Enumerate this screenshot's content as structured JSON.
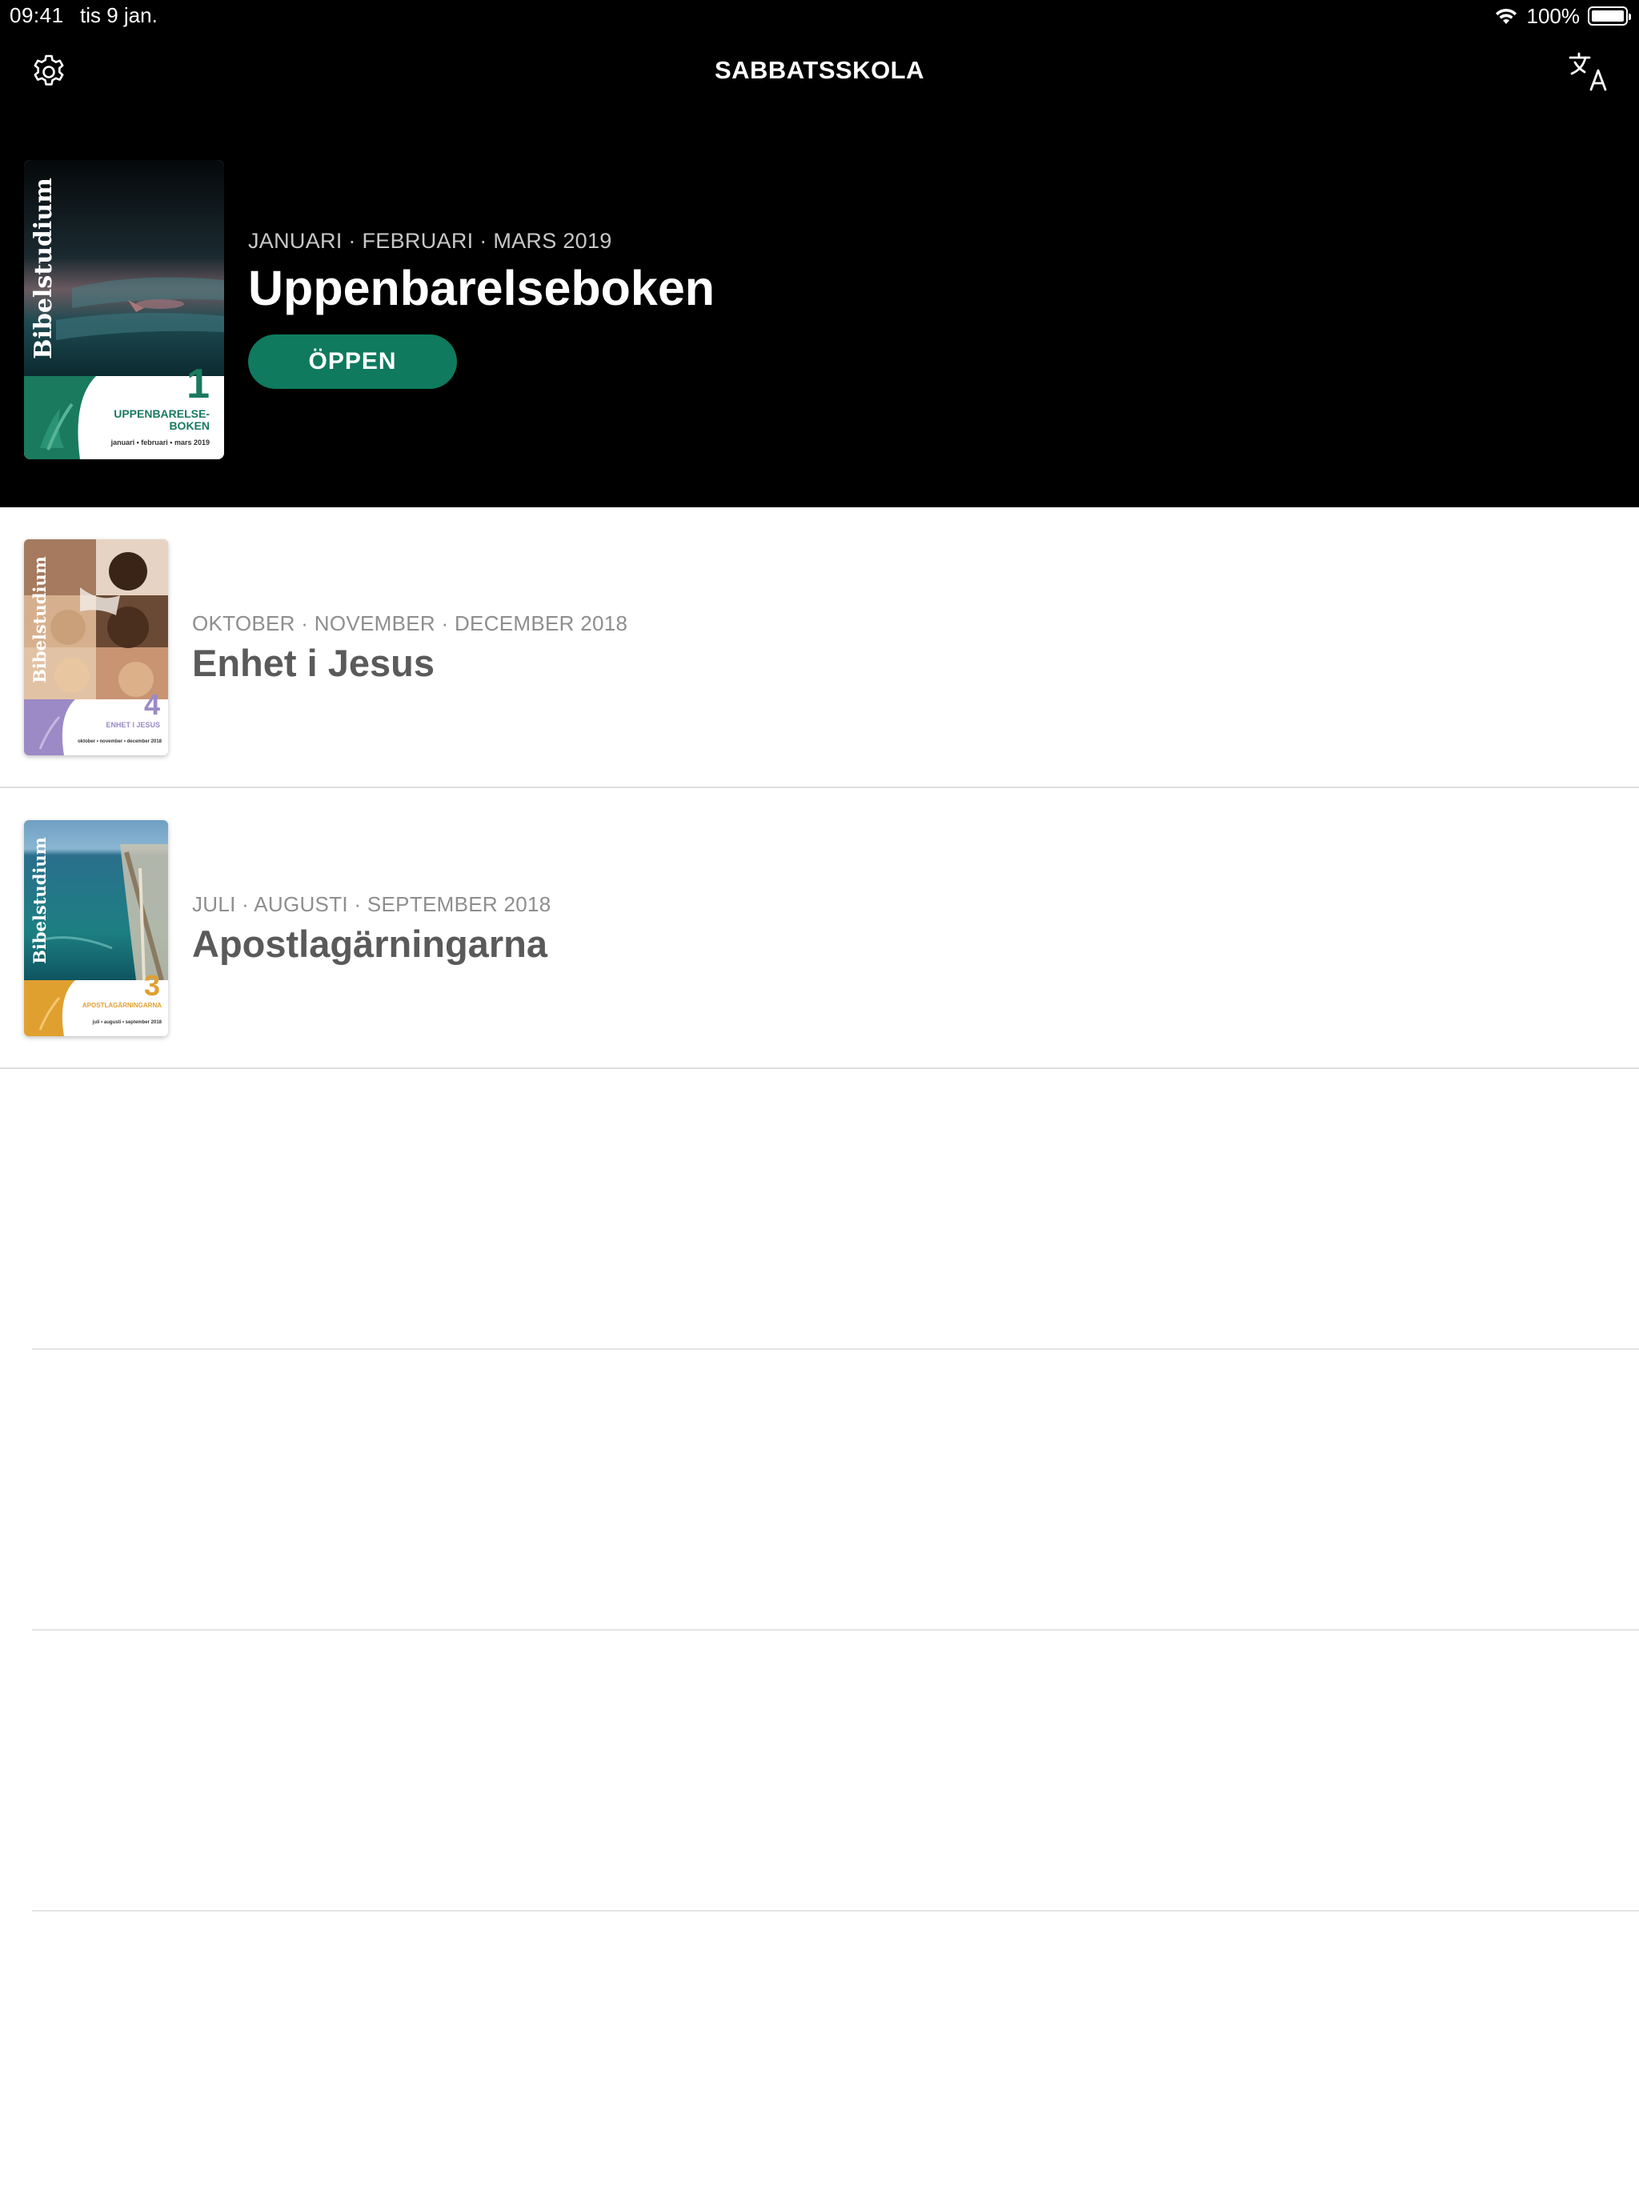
{
  "status_bar": {
    "time": "09:41",
    "date": "tis 9 jan.",
    "battery": "100%"
  },
  "nav": {
    "title": "SABBATSSKOLA",
    "left_icon": "gear-icon",
    "right_icon": "translate-icon"
  },
  "featured": {
    "dates": "JANUARI · FEBRUARI · MARS 2019",
    "title": "Uppenbarelseboken",
    "button_label": "ÖPPEN",
    "accent_color": "#0f7a5e",
    "cover": {
      "series": "Bibelstudium",
      "number": "1",
      "label": "UPPENBARELSE-\nBOKEN",
      "months": "januari • februari • mars 2019",
      "color": "#1a7a5e"
    }
  },
  "quarters": [
    {
      "dates": "OKTOBER · NOVEMBER · DECEMBER 2018",
      "title": "Enhet i Jesus",
      "cover": {
        "series": "Bibelstudium",
        "number": "4",
        "label": "ENHET I JESUS",
        "months": "oktober • november • december 2018",
        "color": "#9b8ac6"
      }
    },
    {
      "dates": "JULI · AUGUSTI · SEPTEMBER 2018",
      "title": "Apostlagärningarna",
      "cover": {
        "series": "Bibelstudium",
        "number": "3",
        "label": "APOSTLAGÄRNINGARNA",
        "months": "juli • augusti • september 2018",
        "color": "#e0a030"
      }
    }
  ]
}
